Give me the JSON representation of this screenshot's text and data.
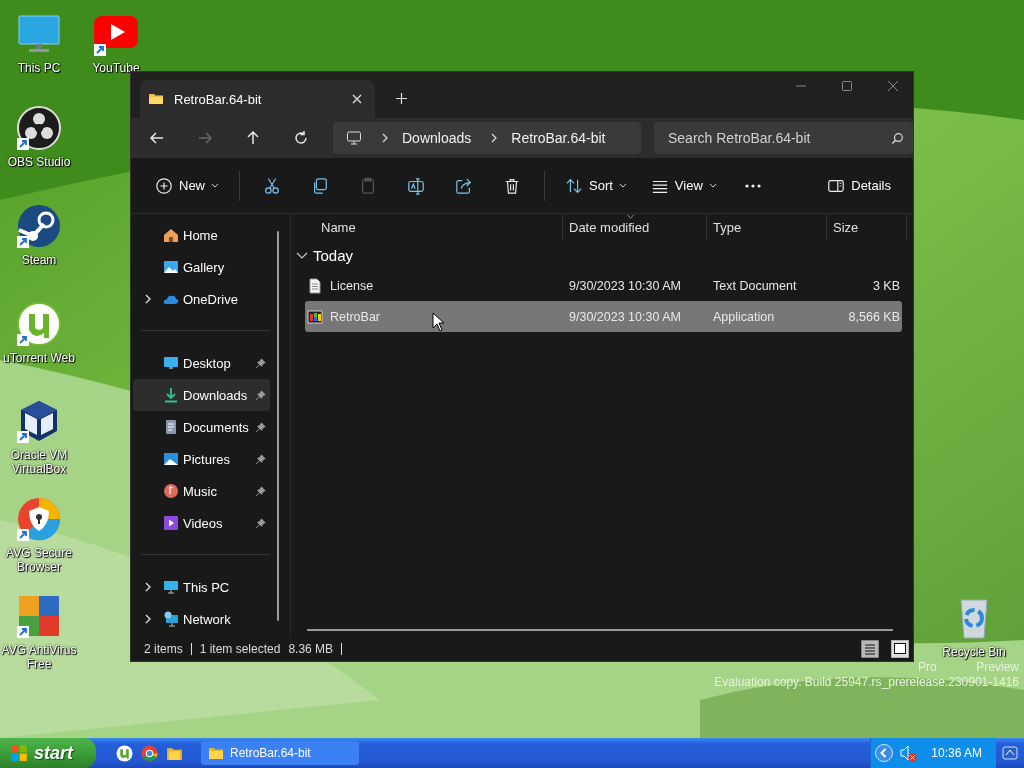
{
  "desktop_icons": [
    {
      "label": "This PC",
      "kind": "monitor",
      "shortcut": false
    },
    {
      "label": "YouTube",
      "kind": "play",
      "shortcut": true
    },
    {
      "label": "OBS Studio",
      "kind": "recorder",
      "shortcut": true
    },
    {
      "label": "Steam",
      "kind": "steam",
      "shortcut": true
    },
    {
      "label": "uTorrent Web",
      "kind": "torrent",
      "shortcut": true
    },
    {
      "label": "Oracle VM VirtualBox",
      "kind": "cube",
      "shortcut": true
    },
    {
      "label": "AVG Secure Browser",
      "kind": "browser",
      "shortcut": true
    },
    {
      "label": "AVG AntiVirus Free",
      "kind": "antivirus",
      "shortcut": true
    },
    {
      "label": "Recycle Bin",
      "kind": "bin",
      "shortcut": false
    }
  ],
  "watermark": {
    "line_1_parts": [
      "Pro",
      "Preview"
    ],
    "line_2": "Evaluation copy. Build 25947.rs_prerelease.230901-1416"
  },
  "window": {
    "tab": {
      "title": "RetroBar.64-bit"
    },
    "nav": [
      {
        "kind": "back",
        "disabled": false
      },
      {
        "kind": "forward",
        "disabled": true
      },
      {
        "kind": "up",
        "disabled": false
      },
      {
        "kind": "refresh",
        "disabled": false
      }
    ],
    "breadcrumbs": [
      "Downloads",
      "RetroBar.64-bit"
    ],
    "search": {
      "placeholder": "Search RetroBar.64-bit"
    },
    "toolbar": {
      "groups": [
        [
          {
            "kind": "new",
            "label": "New",
            "dropdown": true,
            "disabled": false
          }
        ],
        [
          {
            "kind": "cut",
            "disabled": false
          },
          {
            "kind": "copy",
            "disabled": false
          },
          {
            "kind": "paste",
            "disabled": true
          },
          {
            "kind": "rename",
            "disabled": false
          },
          {
            "kind": "share",
            "disabled": false
          },
          {
            "kind": "delete",
            "disabled": false
          }
        ],
        [
          {
            "kind": "sort",
            "label": "Sort",
            "dropdown": true,
            "disabled": false
          },
          {
            "kind": "view",
            "label": "View",
            "dropdown": true,
            "disabled": false
          },
          {
            "kind": "more",
            "disabled": false
          }
        ]
      ],
      "details": {
        "label": "Details"
      }
    },
    "sidebar": {
      "sections": [
        {
          "items": [
            {
              "label": "Home",
              "kind": "home",
              "expandable": false,
              "pinned": false,
              "selected": false
            },
            {
              "label": "Gallery",
              "kind": "gallery",
              "expandable": false,
              "pinned": false,
              "selected": false
            },
            {
              "label": "OneDrive",
              "kind": "cloud",
              "expandable": true,
              "pinned": false,
              "selected": false
            }
          ]
        },
        {
          "items": [
            {
              "label": "Desktop",
              "kind": "desktop",
              "expandable": false,
              "pinned": true,
              "selected": false
            },
            {
              "label": "Downloads",
              "kind": "download",
              "expandable": false,
              "pinned": true,
              "selected": true
            },
            {
              "label": "Documents",
              "kind": "document",
              "expandable": false,
              "pinned": true,
              "selected": false
            },
            {
              "label": "Pictures",
              "kind": "pictures",
              "expandable": false,
              "pinned": true,
              "selected": false
            },
            {
              "label": "Music",
              "kind": "music",
              "expandable": false,
              "pinned": true,
              "selected": false
            },
            {
              "label": "Videos",
              "kind": "videos",
              "expandable": false,
              "pinned": true,
              "selected": false
            }
          ]
        },
        {
          "items": [
            {
              "label": "This PC",
              "kind": "pc",
              "expandable": true,
              "pinned": false,
              "selected": false
            },
            {
              "label": "Network",
              "kind": "network",
              "expandable": true,
              "pinned": false,
              "selected": false
            }
          ]
        }
      ]
    },
    "columns": [
      {
        "label": "Name",
        "sorted": false
      },
      {
        "label": "Date modified",
        "sorted": true
      },
      {
        "label": "Type",
        "sorted": false
      },
      {
        "label": "Size",
        "sorted": false
      }
    ],
    "group": {
      "label": "Today",
      "expanded": true
    },
    "files": [
      {
        "name": "License",
        "kind": "text",
        "date": "9/30/2023 10:30 AM",
        "type": "Text Document",
        "size": "3 KB",
        "selected": false
      },
      {
        "name": "RetroBar",
        "kind": "app",
        "date": "9/30/2023 10:30 AM",
        "type": "Application",
        "size": "8,566 KB",
        "selected": true
      }
    ],
    "status_bar": {
      "count": "2 items",
      "selection": "1 item selected",
      "size": "8.36 MB"
    },
    "view_buttons": [
      {
        "kind": "details",
        "selected": true
      },
      {
        "kind": "tiles",
        "selected": false
      }
    ]
  },
  "taskbar": {
    "start": "start",
    "quick_launch": [
      {
        "kind": "torrent"
      },
      {
        "kind": "chrome"
      },
      {
        "kind": "folder"
      }
    ],
    "tasks": [
      {
        "label": "RetroBar.64-bit",
        "selected": false
      }
    ],
    "clock": "10:36 AM",
    "volume_muted": true
  }
}
